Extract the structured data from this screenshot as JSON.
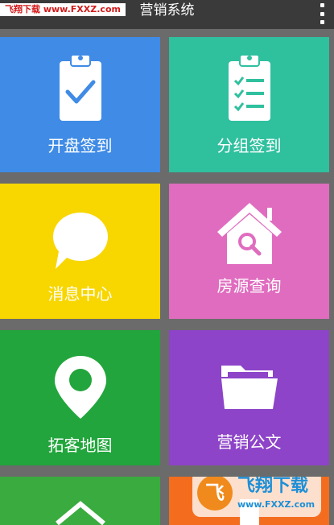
{
  "header": {
    "title": "营销系统",
    "menu_icon": "overflow-menu-icon"
  },
  "watermark": {
    "top_text": "飞翔下载 www.FXXZ.com",
    "badge_name": "飞翔下载",
    "badge_site": "www.FXXZ.com"
  },
  "tiles": [
    {
      "label": "开盘签到",
      "icon": "clipboard-check-icon",
      "color": "#3f8be6"
    },
    {
      "label": "分组签到",
      "icon": "clipboard-list-icon",
      "color": "#2fc09e"
    },
    {
      "label": "消息中心",
      "icon": "chat-bubble-icon",
      "color": "#f8d600"
    },
    {
      "label": "房源查询",
      "icon": "house-search-icon",
      "color": "#e06cbf"
    },
    {
      "label": "拓客地图",
      "icon": "map-pin-icon",
      "color": "#22a53c"
    },
    {
      "label": "营销公文",
      "icon": "folder-icon",
      "color": "#8d44c8"
    },
    {
      "label": "",
      "icon": "house-icon",
      "color": "#3aab3f"
    },
    {
      "label": "",
      "icon": "document-icon",
      "color": "#f46d1f"
    }
  ]
}
